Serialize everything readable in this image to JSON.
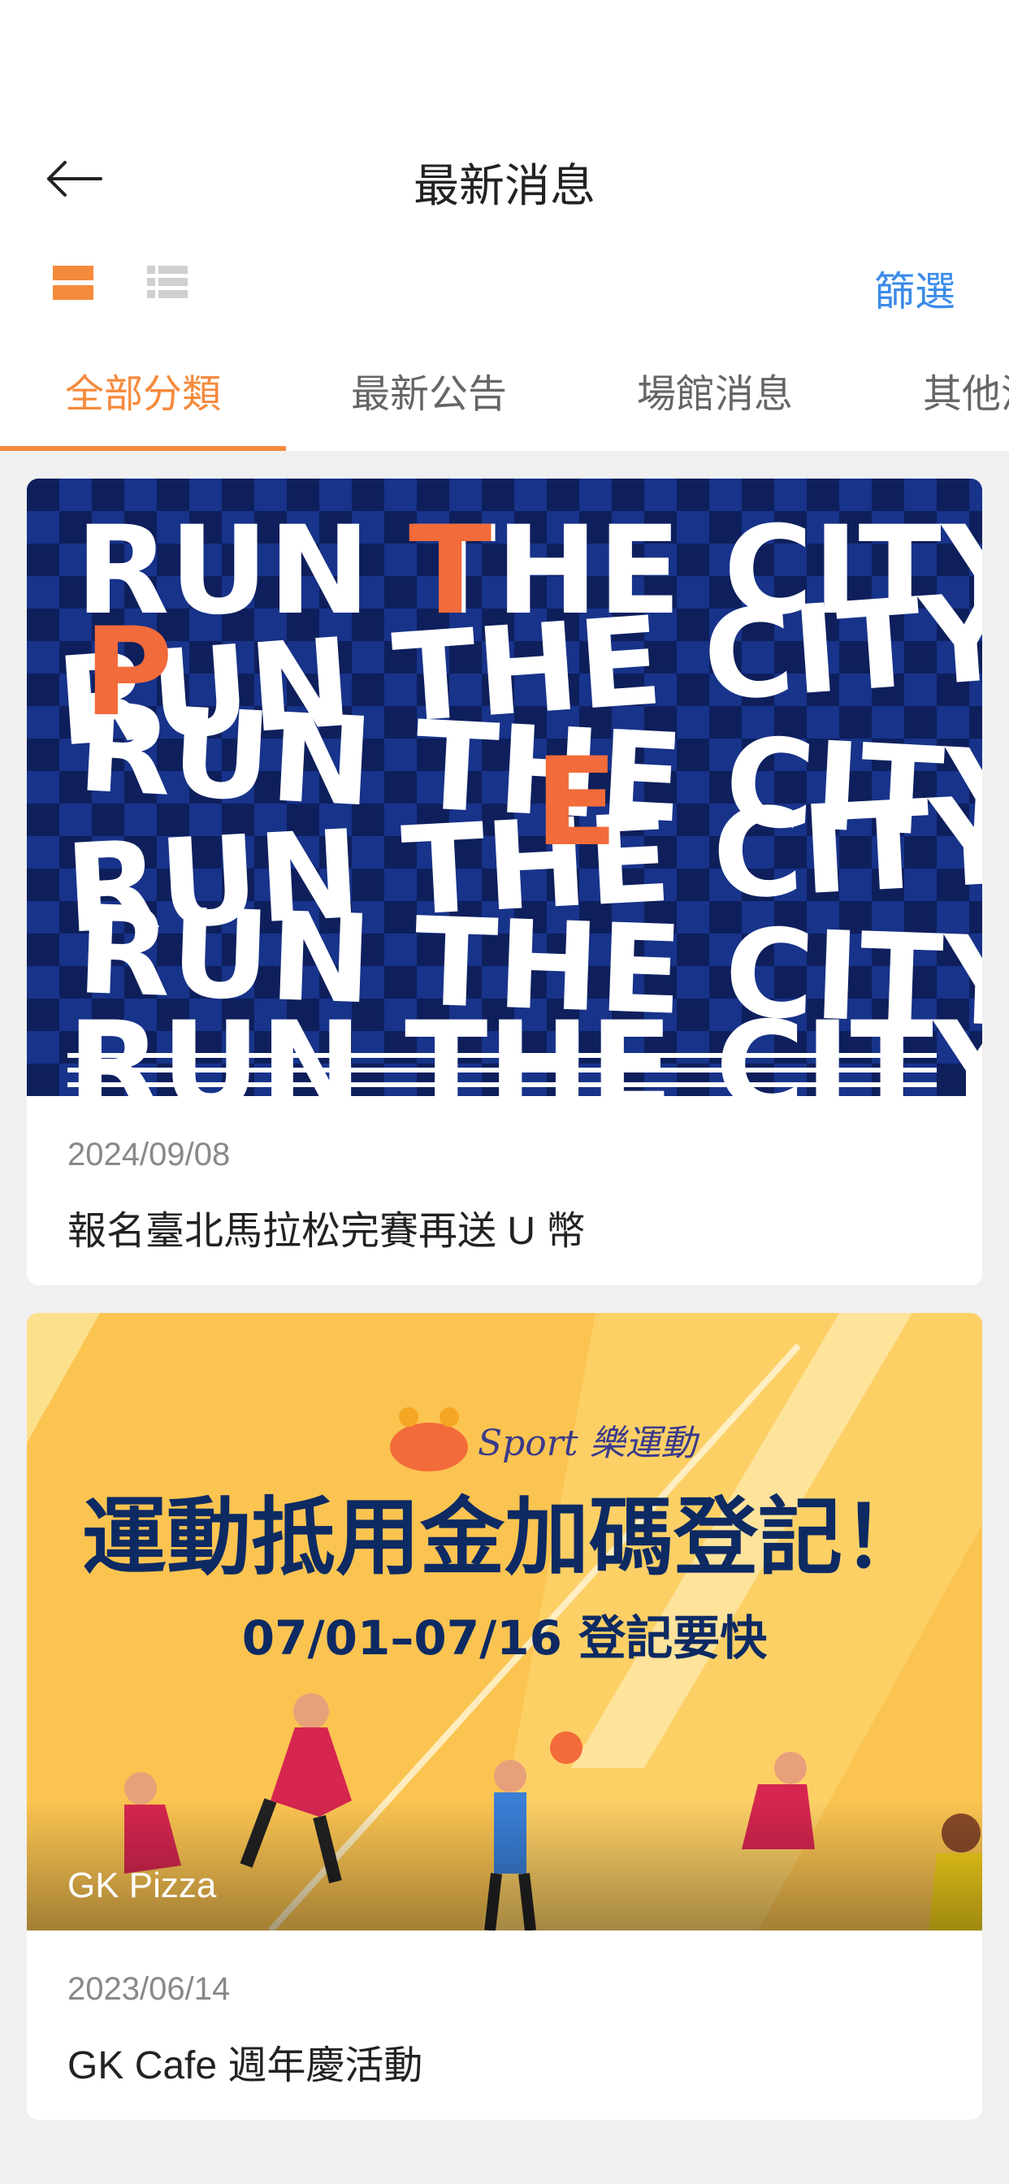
{
  "header": {
    "title": "最新消息",
    "back_icon": "arrow-left-icon"
  },
  "toolbar": {
    "view_card_icon": "card-view-icon",
    "view_list_icon": "list-view-icon",
    "filter_label": "篩選",
    "accent_color": "#f58a3d",
    "link_color": "#3b8be8"
  },
  "tabs": [
    {
      "label": "全部分類",
      "active": true
    },
    {
      "label": "最新公告",
      "active": false
    },
    {
      "label": "場館消息",
      "active": false
    },
    {
      "label": "其他消息",
      "active": false
    }
  ],
  "news": [
    {
      "date": "2024/09/08",
      "title": "報名臺北馬拉松完賽再送 U 幣",
      "image_lines": [
        "RUN THE CITY",
        "RUN THE CITY",
        "RUN THE CITY",
        "RUN THE CITY",
        "RUN THE CITY",
        "RUN THE CITY"
      ]
    },
    {
      "date": "2023/06/14",
      "title": "GK Cafe 週年慶活動",
      "image_overlay_label": "GK Pizza",
      "image_brand": "Sport 樂運動",
      "image_headline": "運動抵用金加碼登記！",
      "image_subline": "07/01–07/16 登記要快"
    }
  ]
}
